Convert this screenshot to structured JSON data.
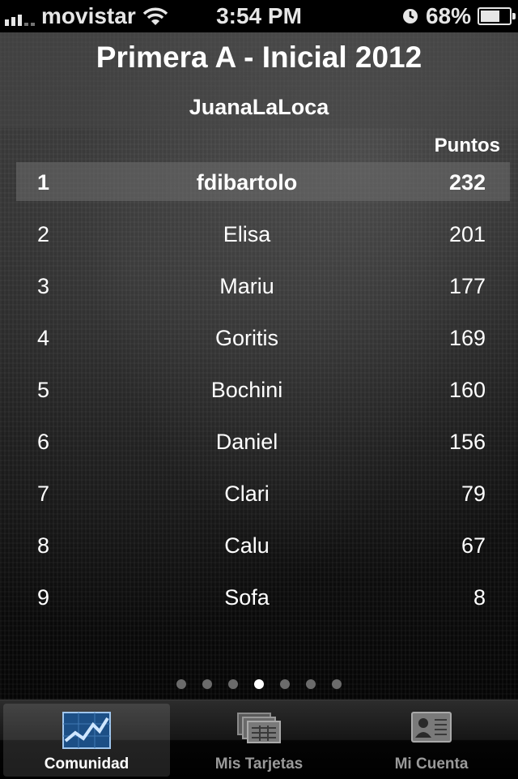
{
  "status_bar": {
    "carrier": "movistar",
    "time": "3:54 PM",
    "battery": "68%",
    "battery_level": 0.68
  },
  "header": {
    "title": "Primera A - Inicial 2012",
    "subtitle": "JuanaLaLoca"
  },
  "table": {
    "points_header": "Puntos",
    "rows": [
      {
        "pos": "1",
        "name": "fdibartolo",
        "points": "232"
      },
      {
        "pos": "2",
        "name": "Elisa",
        "points": "201"
      },
      {
        "pos": "3",
        "name": "Mariu",
        "points": "177"
      },
      {
        "pos": "4",
        "name": "Goritis",
        "points": "169"
      },
      {
        "pos": "5",
        "name": "Bochini",
        "points": "160"
      },
      {
        "pos": "6",
        "name": "Daniel",
        "points": "156"
      },
      {
        "pos": "7",
        "name": "Clari",
        "points": "79"
      },
      {
        "pos": "8",
        "name": "Calu",
        "points": "67"
      },
      {
        "pos": "9",
        "name": "Sofa",
        "points": "8"
      }
    ]
  },
  "pager": {
    "total_pages": 7,
    "current_page": 4
  },
  "tabs": [
    {
      "label": "Comunidad",
      "icon": "chart-icon",
      "active": true
    },
    {
      "label": "Mis Tarjetas",
      "icon": "cards-icon",
      "active": false
    },
    {
      "label": "Mi Cuenta",
      "icon": "profile-card-icon",
      "active": false
    }
  ]
}
